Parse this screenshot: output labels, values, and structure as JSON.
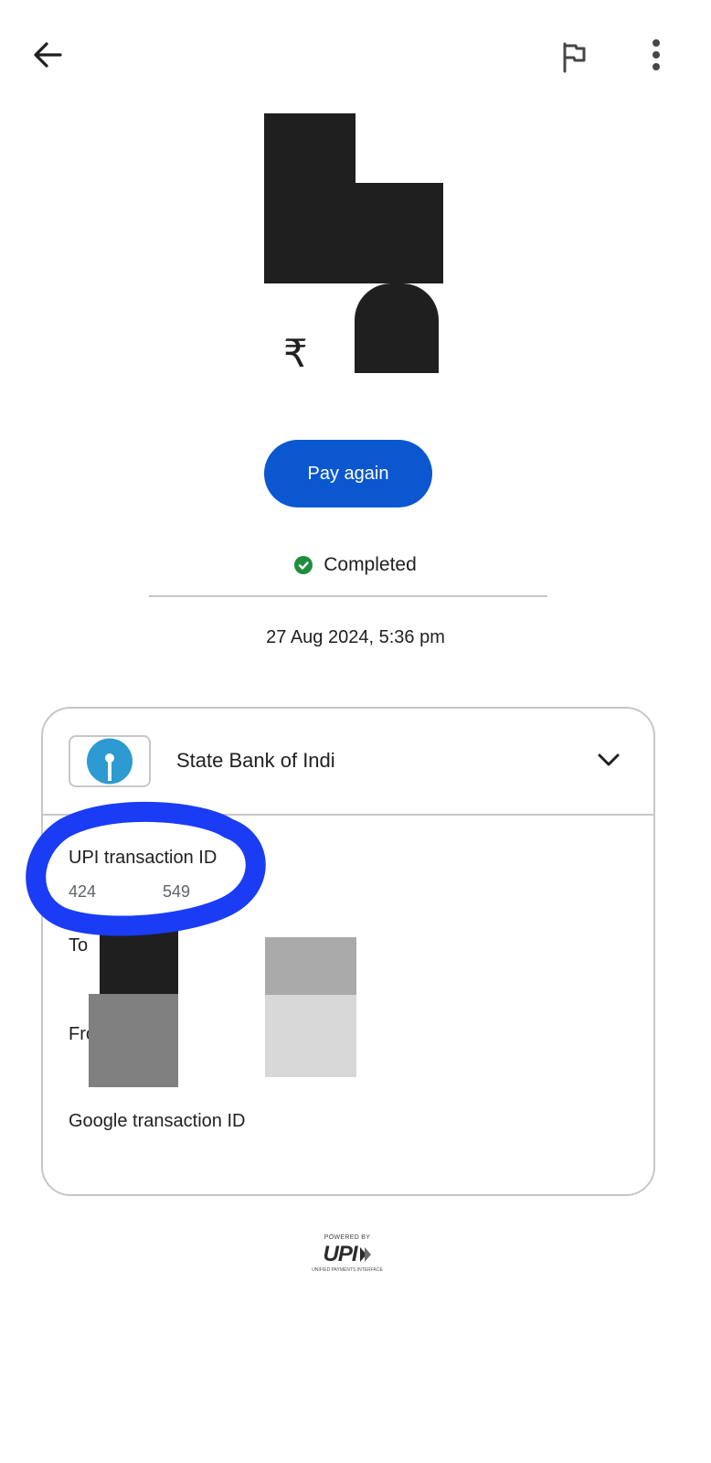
{
  "topbar": {
    "back_icon": "arrow-back-icon",
    "flag_icon": "flag-icon",
    "more_icon": "more-vert-icon"
  },
  "amount": {
    "currency_symbol": "₹"
  },
  "actions": {
    "pay_again_label": "Pay again"
  },
  "status": {
    "label": "Completed",
    "color": "#1e8e3e"
  },
  "datetime": "27 Aug 2024, 5:36 pm",
  "card": {
    "bank_name": "State Bank of Indi",
    "upi_txn_label": "UPI transaction ID",
    "upi_txn_value_start": "424",
    "upi_txn_value_end": "549",
    "to_label": "To",
    "from_label": "From:",
    "google_txn_label": "Google transaction ID"
  },
  "footer": {
    "powered_by": "POWERED BY",
    "upi_text": "UPI",
    "upi_subtext": "UNIFIED PAYMENTS INTERFACE"
  },
  "colors": {
    "primary": "#0b57d0",
    "annotation": "#1a3cf5",
    "sbi_blue": "#2d9bd2"
  }
}
